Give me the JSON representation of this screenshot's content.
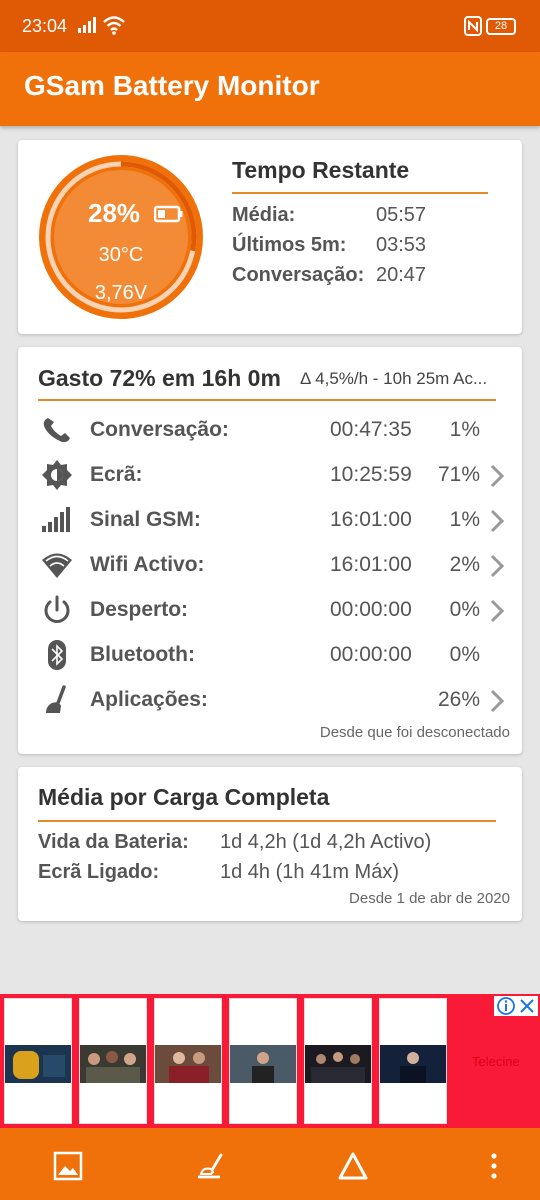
{
  "status_bar": {
    "time": "23:04",
    "battery_level": "28"
  },
  "app": {
    "title": "GSam Battery Monitor"
  },
  "battery": {
    "percent": "28%",
    "level_fraction": 0.28,
    "temperature": "30°C",
    "voltage": "3,76V"
  },
  "time_remaining": {
    "title": "Tempo Restante",
    "rows": [
      {
        "label": "Média:",
        "value": "05:57"
      },
      {
        "label": "Últimos 5m:",
        "value": "03:53"
      },
      {
        "label": "Conversação:",
        "value": "20:47"
      }
    ]
  },
  "usage": {
    "title": "Gasto 72% em 16h 0m",
    "subtitle": "Δ 4,5%/h - 10h 25m Ac...",
    "rows": [
      {
        "icon": "phone-icon",
        "label": "Conversação:",
        "time": "00:47:35",
        "percent": "1%",
        "has_detail": false
      },
      {
        "icon": "brightness-icon",
        "label": "Ecrã:",
        "time": "10:25:59",
        "percent": "71%",
        "has_detail": true
      },
      {
        "icon": "signal-icon",
        "label": "Sinal GSM:",
        "time": "16:01:00",
        "percent": "1%",
        "has_detail": true
      },
      {
        "icon": "wifi-icon",
        "label": "Wifi Activo:",
        "time": "16:01:00",
        "percent": "2%",
        "has_detail": true
      },
      {
        "icon": "power-icon",
        "label": "Desperto:",
        "time": "00:00:00",
        "percent": "0%",
        "has_detail": true
      },
      {
        "icon": "bluetooth-icon",
        "label": "Bluetooth:",
        "time": "00:00:00",
        "percent": "0%",
        "has_detail": false
      },
      {
        "icon": "broom-icon",
        "label": "Aplicações:",
        "time": "",
        "percent": "26%",
        "has_detail": true
      }
    ],
    "footer": "Desde que foi desconectado"
  },
  "average": {
    "title": "Média por Carga Completa",
    "rows": [
      {
        "label": "Vida da Bateria:",
        "value": "1d 4,2h (1d 4,2h Activo)"
      },
      {
        "label": "Ecrã Ligado:",
        "value": "1d 4h (1h 41m Máx)"
      }
    ],
    "footer": "Desde 1 de abr de 2020"
  },
  "ad": {
    "cta": "Telecine"
  },
  "colors": {
    "primary": "#f07009",
    "status": "#e05a06",
    "accent_line": "#e58a2a",
    "ad_bg": "#f81a37"
  }
}
